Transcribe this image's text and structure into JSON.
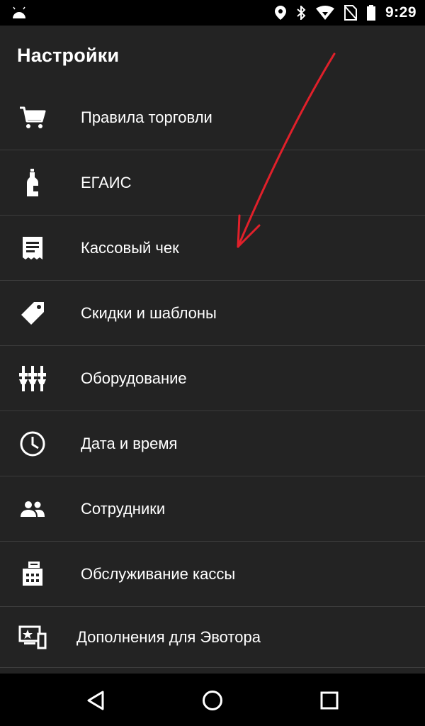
{
  "status_bar": {
    "time": "9:29"
  },
  "app_bar": {
    "title": "Настройки"
  },
  "settings": {
    "items": [
      {
        "label": "Правила торговли",
        "icon": "cart-icon"
      },
      {
        "label": "ЕГАИС",
        "icon": "bottle-icon"
      },
      {
        "label": "Кассовый чек",
        "icon": "receipt-icon"
      },
      {
        "label": "Скидки и шаблоны",
        "icon": "tag-icon"
      },
      {
        "label": "Оборудование",
        "icon": "equalizer-icon"
      },
      {
        "label": "Дата и время",
        "icon": "clock-icon"
      },
      {
        "label": "Сотрудники",
        "icon": "people-icon"
      },
      {
        "label": "Обслуживание кассы",
        "icon": "fax-icon"
      },
      {
        "label": "Дополнения для Эвотора",
        "icon": "devices-star-icon"
      }
    ]
  },
  "colors": {
    "background": "#232323",
    "divider": "#3c3c3c",
    "annotation_arrow": "#e0202a"
  }
}
